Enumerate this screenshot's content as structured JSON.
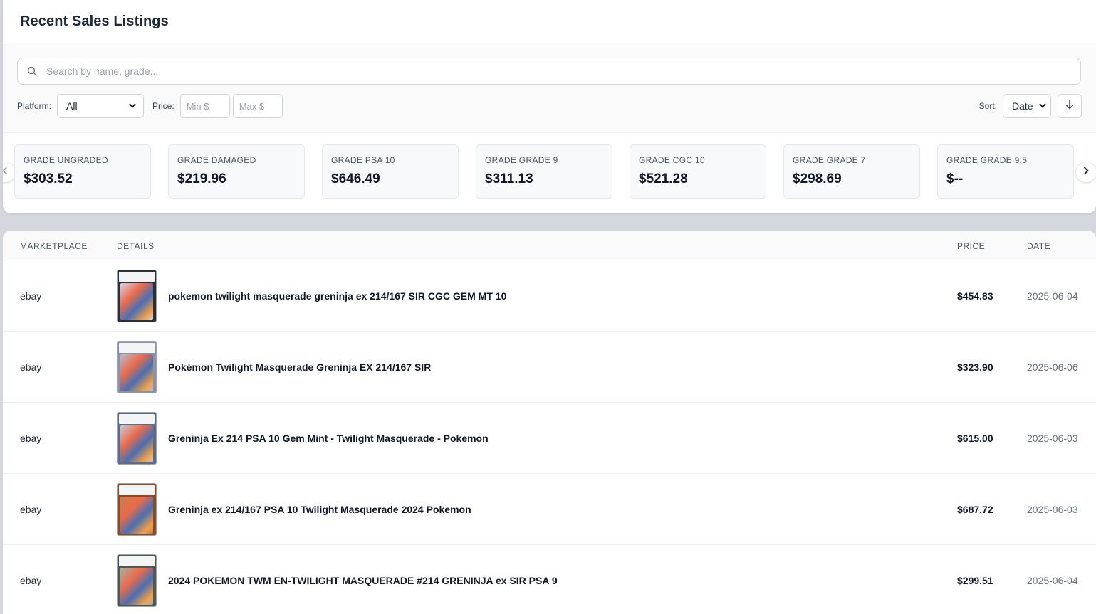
{
  "header": {
    "title": "Recent Sales Listings"
  },
  "search": {
    "placeholder": "Search by name, grade..."
  },
  "filters": {
    "platform_label": "Platform:",
    "platform_value": "All",
    "price_label": "Price:",
    "min_placeholder": "Min $",
    "max_placeholder": "Max $",
    "sort_label": "Sort:",
    "sort_value": "Date"
  },
  "grade_stats": [
    {
      "label": "GRADE UNGRADED",
      "value": "$303.52"
    },
    {
      "label": "GRADE DAMAGED",
      "value": "$219.96"
    },
    {
      "label": "GRADE PSA 10",
      "value": "$646.49"
    },
    {
      "label": "GRADE GRADE 9",
      "value": "$311.13"
    },
    {
      "label": "GRADE CGC 10",
      "value": "$521.28"
    },
    {
      "label": "GRADE GRADE 7",
      "value": "$298.69"
    },
    {
      "label": "GRADE GRADE 9.5",
      "value": "$--"
    }
  ],
  "table": {
    "columns": {
      "marketplace": "MARKETPLACE",
      "details": "DETAILS",
      "price": "PRICE",
      "date": "DATE"
    },
    "rows": [
      {
        "marketplace": "ebay",
        "title": "pokemon twilight masquerade greninja ex 214/167 SIR CGC GEM MT 10",
        "price": "$454.83",
        "date": "2025-06-04",
        "slab": "#2b2f3a",
        "bg": "#d9d4e6"
      },
      {
        "marketplace": "ebay",
        "title": "Pokémon Twilight Masquerade Greninja EX 214/167 SIR",
        "price": "$323.90",
        "date": "2025-06-06",
        "slab": "#8c93a8",
        "bg": "#b9bdd0"
      },
      {
        "marketplace": "ebay",
        "title": "Greninja Ex 214 PSA 10 Gem Mint - Twilight Masquerade - Pokemon",
        "price": "$615.00",
        "date": "2025-06-03",
        "slab": "#5d6b86",
        "bg": "#c6ccd8"
      },
      {
        "marketplace": "ebay",
        "title": "Greninja ex 214/167 PSA 10 Twilight Masquerade 2024 Pokemon",
        "price": "$687.72",
        "date": "2025-06-03",
        "slab": "#8a4b24",
        "bg": "#c97e4a"
      },
      {
        "marketplace": "ebay",
        "title": "2024 POKEMON TWM EN-TWILIGHT MASQUERADE #214 GRENINJA ex SIR PSA 9",
        "price": "$299.51",
        "date": "2025-06-04",
        "slab": "#4e5a4f",
        "bg": "#a7b2a6"
      }
    ]
  },
  "icons": {
    "search": "search-icon",
    "chevron": "chevron-down-icon",
    "sort_direction": "arrow-down-icon",
    "prev": "chevron-left-icon",
    "next": "chevron-right-icon"
  }
}
